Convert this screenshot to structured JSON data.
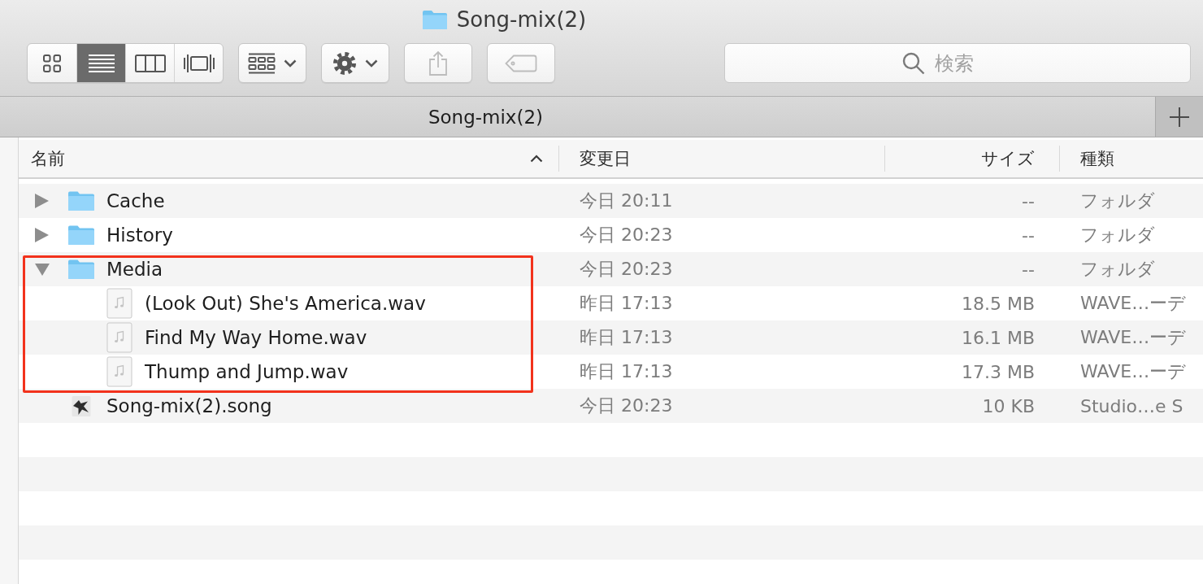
{
  "window": {
    "title": "Song-mix(2)"
  },
  "toolbar": {
    "view_modes": [
      {
        "kind": "icons",
        "selected": false
      },
      {
        "kind": "list",
        "selected": true
      },
      {
        "kind": "columns",
        "selected": false
      },
      {
        "kind": "gallery",
        "selected": false
      }
    ],
    "buttons": [
      {
        "kind": "group",
        "disabled": false
      },
      {
        "kind": "action",
        "disabled": false
      },
      {
        "kind": "share",
        "disabled": true
      },
      {
        "kind": "tags",
        "disabled": true
      }
    ],
    "search": {
      "placeholder": "検索"
    }
  },
  "tab_bar": {
    "tabs": [
      {
        "label": "Song-mix(2)"
      }
    ]
  },
  "table": {
    "columns": [
      {
        "label": "名前",
        "sorted": true
      },
      {
        "label": "変更日",
        "sorted": false
      },
      {
        "label": "サイズ",
        "sorted": false
      },
      {
        "label": "種類",
        "sorted": false
      }
    ],
    "rows": [
      {
        "kind": "folder",
        "name": "Cache",
        "modified": "今日 20:11",
        "size": "--",
        "type": "フォルダ",
        "expanded": false,
        "highlighted": false
      },
      {
        "kind": "folder",
        "name": "History",
        "modified": "今日 20:23",
        "size": "--",
        "type": "フォルダ",
        "expanded": false,
        "highlighted": false
      },
      {
        "kind": "folder",
        "name": "Media",
        "modified": "今日 20:23",
        "size": "--",
        "type": "フォルダ",
        "expanded": true,
        "highlighted": true,
        "children": [
          {
            "kind": "audio",
            "name": "(Look Out) She's America.wav",
            "modified": "昨日 17:13",
            "size": "18.5 MB",
            "type": "WAVE…ーデ",
            "highlighted": true
          },
          {
            "kind": "audio",
            "name": "Find My Way Home.wav",
            "modified": "昨日 17:13",
            "size": "16.1 MB",
            "type": "WAVE…ーデ",
            "highlighted": true
          },
          {
            "kind": "audio",
            "name": "Thump and Jump.wav",
            "modified": "昨日 17:13",
            "size": "17.3 MB",
            "type": "WAVE…ーデ",
            "highlighted": true
          }
        ]
      },
      {
        "kind": "project",
        "name": "Song-mix(2).song",
        "modified": "今日 20:23",
        "size": "10 KB",
        "type": "Studio…e S",
        "highlighted": false
      }
    ]
  }
}
